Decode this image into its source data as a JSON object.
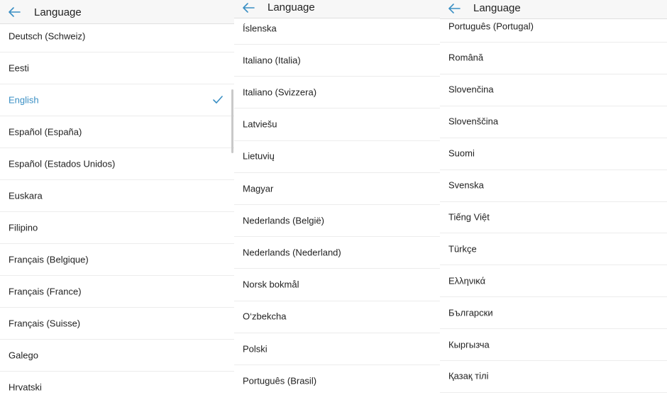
{
  "panels": [
    {
      "title": "Language",
      "items": [
        "Deutsch (Schweiz)",
        "Eesti",
        "English",
        "Español (España)",
        "Español (Estados Unidos)",
        "Euskara",
        "Filipino",
        "Français (Belgique)",
        "Français (France)",
        "Français (Suisse)",
        "Galego",
        "Hrvatski"
      ],
      "selected": "English"
    },
    {
      "title": "Language",
      "items": [
        "Íslenska",
        "Italiano (Italia)",
        "Italiano (Svizzera)",
        "Latviešu",
        "Lietuvių",
        "Magyar",
        "Nederlands (België)",
        "Nederlands (Nederland)",
        "Norsk bokmål",
        "O‘zbekcha",
        "Polski",
        "Português (Brasil)"
      ],
      "selected": null
    },
    {
      "title": "Language",
      "items": [
        "Português (Portugal)",
        "Română",
        "Slovenčina",
        "Slovenščina",
        "Suomi",
        "Svenska",
        "Tiếng Việt",
        "Türkçe",
        "Ελληνικά",
        "Български",
        "Кыргызча",
        "Қазақ тілі"
      ],
      "selected": null
    }
  ],
  "icons": {
    "back": "arrow-left-icon",
    "selected": "checkmark-icon"
  },
  "colors": {
    "accent": "#3a8fc4",
    "text": "#222222",
    "header_bg": "#f7f7f7",
    "divider": "#ececec"
  }
}
